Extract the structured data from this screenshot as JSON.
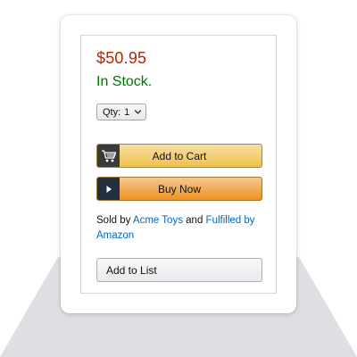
{
  "product": {
    "price": "$50.95",
    "stock": "In Stock."
  },
  "quantity": {
    "label": "Qty:",
    "value": "1"
  },
  "buttons": {
    "add_to_cart": "Add to Cart",
    "buy_now": "Buy Now",
    "add_to_list": "Add to List"
  },
  "seller": {
    "sold_prefix": "Sold by",
    "seller_name": "Acme Toys",
    "and": "and",
    "fulfilled_by": "Fulfilled by",
    "fulfiller": "Amazon"
  },
  "colors": {
    "price": "#b12704",
    "in_stock": "#007600",
    "link": "#0066c0",
    "cart_button": "#f0c14b",
    "buy_button": "#ed9220"
  },
  "icons": {
    "cart": "cart-icon",
    "buy": "play-icon",
    "dropdown": "chevron-down-icon"
  }
}
